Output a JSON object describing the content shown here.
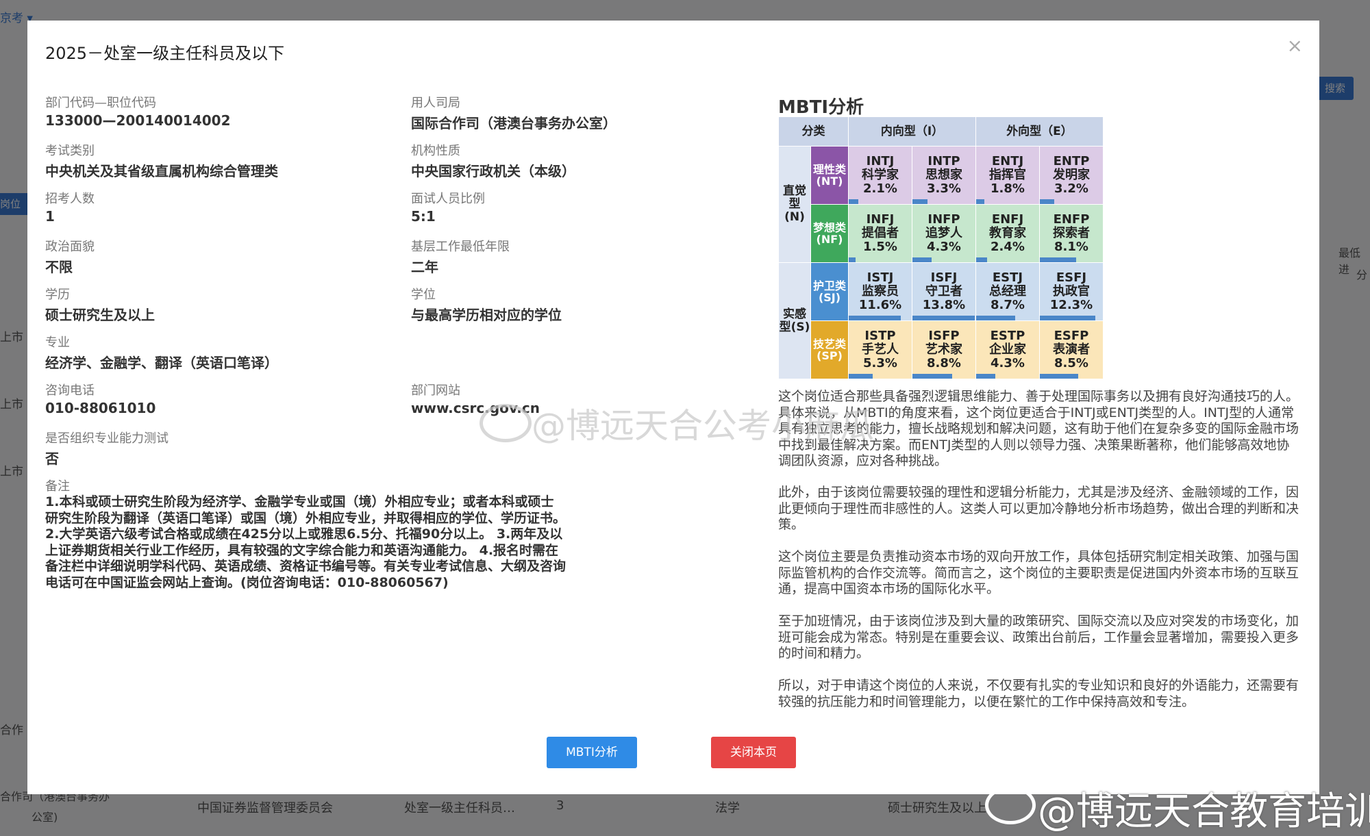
{
  "background": {
    "tab_label": "京考 ▾",
    "search_label": "搜索",
    "left_labels": [
      "上市",
      "上市",
      "上市",
      "合作",
      "合作司（港澳台事务办",
      "公室)"
    ],
    "left_blue_label": "岗位对",
    "right_labels": [
      "最低进",
      "分"
    ],
    "bottom_row": [
      "中国证券监督管理委员会",
      "处室一级主任科员…",
      "3",
      "法学",
      "硕士研究生及以上"
    ]
  },
  "modal": {
    "title": "2025－处室一级主任科员及以下",
    "close_icon": "×",
    "fields_left": [
      {
        "label": "部门代码—职位代码",
        "value": "133000—200140014002"
      },
      {
        "label": "考试类别",
        "value": "中央机关及其省级直属机构综合管理类"
      },
      {
        "label": "招考人数",
        "value": "1"
      },
      {
        "label": "政治面貌",
        "value": "不限"
      },
      {
        "label": "学历",
        "value": "硕士研究生及以上"
      },
      {
        "label": "专业",
        "value": "经济学、金融学、翻译（英语口笔译）"
      },
      {
        "label": "咨询电话",
        "value": "010-88061010"
      },
      {
        "label": "是否组织专业能力测试",
        "value": "否"
      }
    ],
    "fields_right": [
      {
        "label": "用人司局",
        "value": "国际合作司（港澳台事务办公室）"
      },
      {
        "label": "机构性质",
        "value": "中央国家行政机关（本级）"
      },
      {
        "label": "面试人员比例",
        "value": "5:1"
      },
      {
        "label": "基层工作最低年限",
        "value": "二年"
      },
      {
        "label": "学位",
        "value": "与最高学历相对应的学位"
      },
      {
        "label": "部门网站",
        "value": "www.csrc.gov.cn"
      }
    ],
    "remark_label": "备注",
    "remark_text": "1.本科或硕士研究生阶段为经济学、金融学专业或国（境）外相应专业；或者本科或硕士研究生阶段为翻译（英语口笔译）或国（境）外相应专业，并取得相应的学位、学历证书。 2.大学英语六级考试合格或成绩在425分以上或雅思6.5分、托福90分以上。 3.两年及以上证券期货相关行业工作经历，具有较强的文字综合能力和英语沟通能力。 4.报名时需在备注栏中详细说明学科代码、英语成绩、资格证书编号等。有关专业考试信息、大纲及咨询电话可在中国证监会网站上查询。(岗位咨询电话：010-88060567)",
    "mbti": {
      "title": "MBTI分析",
      "header": {
        "category": "分类",
        "introvert": "内向型（I）",
        "extrovert": "外向型（E）"
      },
      "groups": [
        {
          "label": "直觉型(N)"
        },
        {
          "label": "实感型(S)"
        }
      ],
      "rows": [
        {
          "sub": "理性类(NT)",
          "class": "nt",
          "cells": [
            {
              "code": "INTJ",
              "name": "科学家",
              "pct": "2.1%",
              "value": 2.1
            },
            {
              "code": "INTP",
              "name": "思想家",
              "pct": "3.3%",
              "value": 3.3
            },
            {
              "code": "ENTJ",
              "name": "指挥官",
              "pct": "1.8%",
              "value": 1.8
            },
            {
              "code": "ENTP",
              "name": "发明家",
              "pct": "3.2%",
              "value": 3.2
            }
          ]
        },
        {
          "sub": "梦想类(NF)",
          "class": "nf",
          "cells": [
            {
              "code": "INFJ",
              "name": "提倡者",
              "pct": "1.5%",
              "value": 1.5
            },
            {
              "code": "INFP",
              "name": "追梦人",
              "pct": "4.3%",
              "value": 4.3
            },
            {
              "code": "ENFJ",
              "name": "教育家",
              "pct": "2.4%",
              "value": 2.4
            },
            {
              "code": "ENFP",
              "name": "探索者",
              "pct": "8.1%",
              "value": 8.1
            }
          ]
        },
        {
          "sub": "护卫类(SJ)",
          "class": "sj",
          "cells": [
            {
              "code": "ISTJ",
              "name": "监察员",
              "pct": "11.6%",
              "value": 11.6
            },
            {
              "code": "ISFJ",
              "name": "守卫者",
              "pct": "13.8%",
              "value": 13.8
            },
            {
              "code": "ESTJ",
              "name": "总经理",
              "pct": "8.7%",
              "value": 8.7
            },
            {
              "code": "ESFJ",
              "name": "执政官",
              "pct": "12.3%",
              "value": 12.3
            }
          ]
        },
        {
          "sub": "技艺类(SP)",
          "class": "sp",
          "cells": [
            {
              "code": "ISTP",
              "name": "手艺人",
              "pct": "5.3%",
              "value": 5.3
            },
            {
              "code": "ISFP",
              "name": "艺术家",
              "pct": "8.8%",
              "value": 8.8
            },
            {
              "code": "ESTP",
              "name": "企业家",
              "pct": "4.3%",
              "value": 4.3
            },
            {
              "code": "ESFP",
              "name": "表演者",
              "pct": "8.5%",
              "value": 8.5
            }
          ]
        }
      ],
      "paragraphs": [
        "这个岗位适合那些具备强烈逻辑思维能力、善于处理国际事务以及拥有良好沟通技巧的人。具体来说，从MBTI的角度来看，这个岗位更适合于INTJ或ENTJ类型的人。INTJ型的人通常具有独立思考的能力，擅长战略规划和解决问题，这有助于他们在复杂多变的国际金融市场中找到最佳解决方案。而ENTJ类型的人则以领导力强、决策果断著称，他们能够高效地协调团队资源，应对各种挑战。",
        "此外，由于该岗位需要较强的理性和逻辑分析能力，尤其是涉及经济、金融领域的工作，因此更倾向于理性而非感性的人。这类人可以更加冷静地分析市场趋势，做出合理的判断和决策。",
        "这个岗位主要是负责推动资本市场的双向开放工作，具体包括研究制定相关政策、加强与国际监管机构的合作交流等。简而言之，这个岗位的主要职责是促进国内外资本市场的互联互通，提高中国资本市场的国际化水平。",
        "至于加班情况，由于该岗位涉及到大量的政策研究、国际交流以及应对突发的市场变化，加班可能会成为常态。特别是在重要会议、政策出台前后，工作量会显著增加，需要投入更多的时间和精力。",
        "所以，对于申请这个岗位的人来说，不仅要有扎实的专业知识和良好的外语能力，还需要有较强的抗压能力和时间管理能力，以便在繁忙的工作中保持高效和专注。"
      ]
    },
    "buttons": {
      "mbti": "MBTI分析",
      "close": "关闭本页"
    }
  },
  "watermarks": {
    "center": "@博远天合公考小麻瓜",
    "corner": "@博远天合教育培训"
  },
  "colors": {
    "primary": "#2f8be6",
    "danger": "#e64545",
    "nt": "#8b55a7",
    "nf": "#3fa85c",
    "sj": "#4a8fd0",
    "sp": "#e2a92a"
  }
}
